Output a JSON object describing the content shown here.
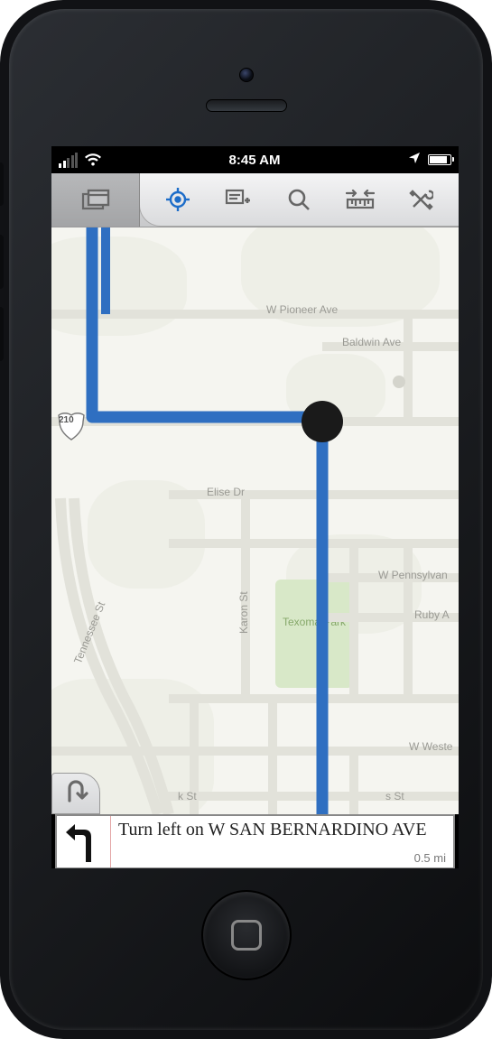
{
  "status": {
    "time": "8:45 AM"
  },
  "map": {
    "labels": {
      "pioneer": "W Pioneer Ave",
      "baldwin": "Baldwin Ave",
      "elise": "Elise Dr",
      "pennsylvania": "W Pennsylvan",
      "ruby": "Ruby A",
      "western": "W Weste",
      "karon": "Karon St",
      "tennessee": "Tennessee St",
      "kst": "k St",
      "sst": "s St",
      "hwy": "210"
    },
    "park": "Texoma Park"
  },
  "direction": {
    "text_prefix": "Turn left on ",
    "street": "W SAN BERNARDINO AVE",
    "distance": "0.5 mi"
  }
}
